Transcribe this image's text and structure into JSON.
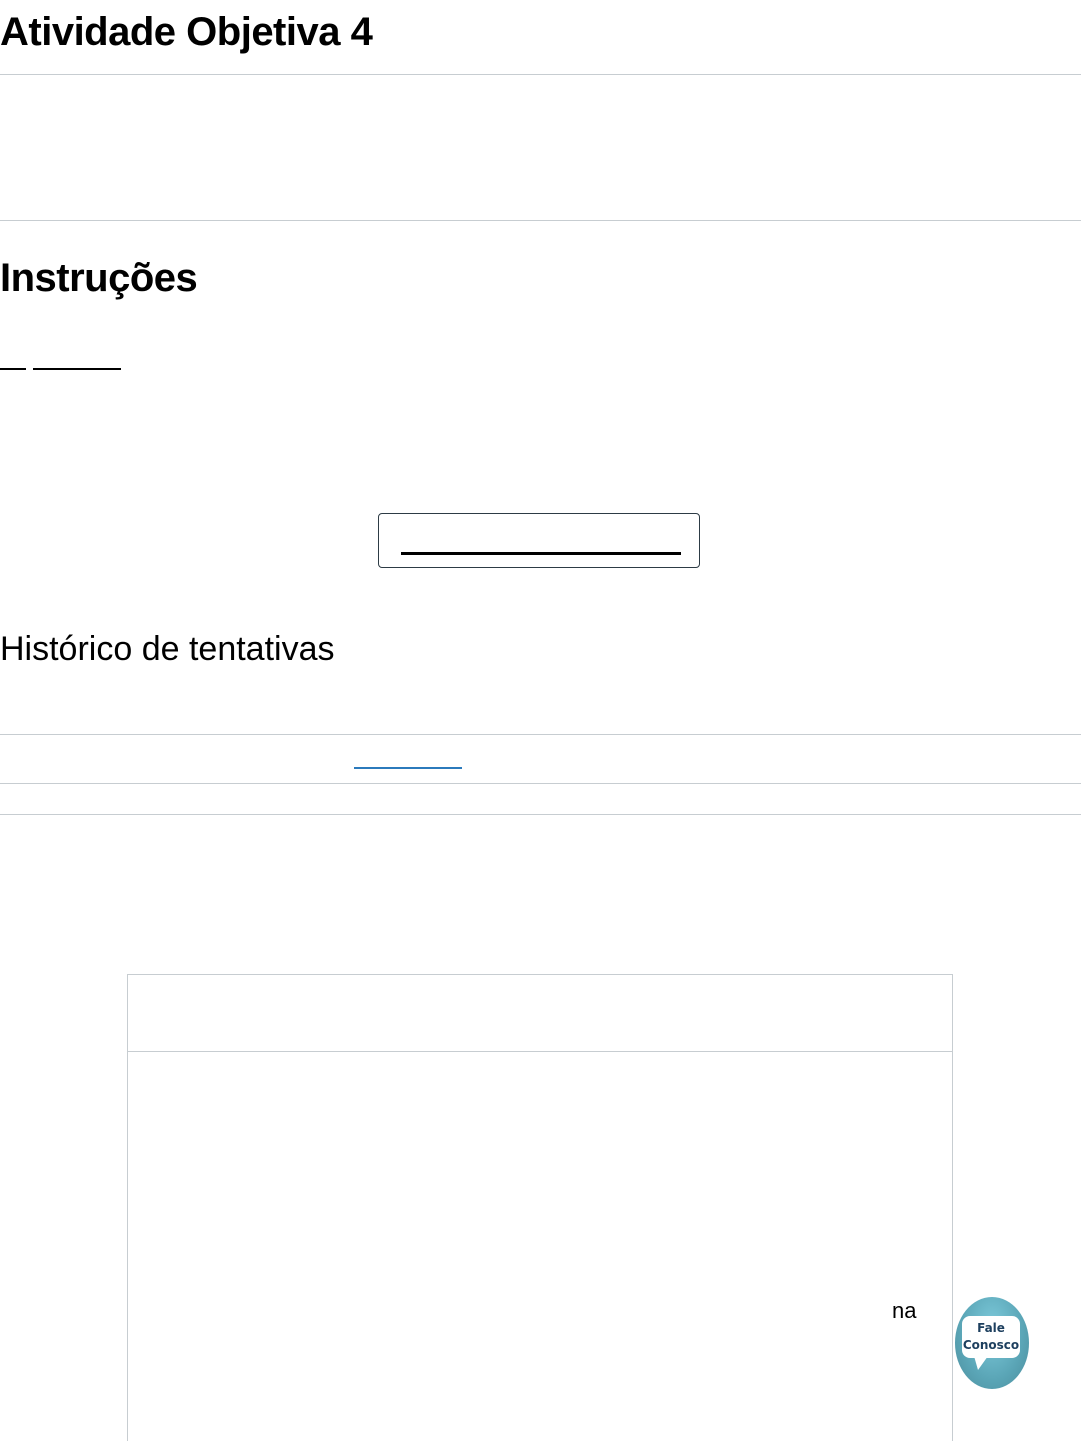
{
  "page": {
    "title": "Atividade Objetiva 4"
  },
  "instructions": {
    "heading": "Instruções"
  },
  "history": {
    "heading": "Histórico de tentativas"
  },
  "content_frame": {
    "visible_fragment": "na"
  },
  "chat_widget": {
    "line1": "Fale",
    "line2": "Conosco",
    "icon": "chat-bubble-icon",
    "accent_color": "#5aa5b6"
  },
  "colors": {
    "link": "#2b7abc",
    "border": "#c7cdd1"
  }
}
